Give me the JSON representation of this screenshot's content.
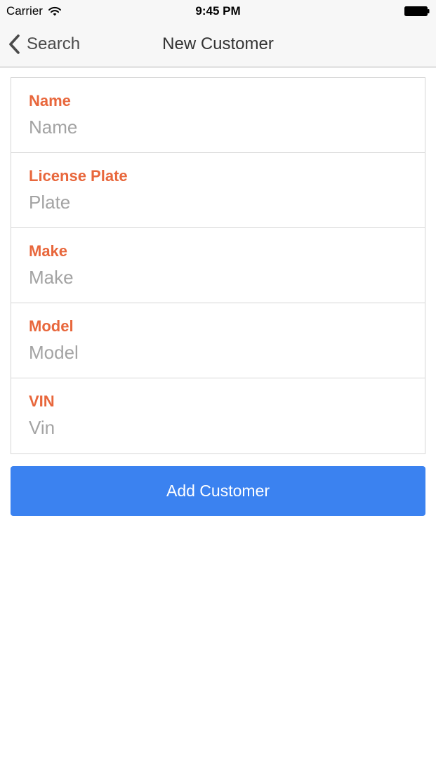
{
  "status_bar": {
    "carrier": "Carrier",
    "time": "9:45 PM",
    "wifi_icon": "wifi-icon",
    "battery_icon": "battery-full-icon"
  },
  "nav": {
    "back_label": "Search",
    "back_icon": "chevron-left-icon",
    "title": "New Customer"
  },
  "form": {
    "fields": [
      {
        "label": "Name",
        "placeholder": "Name",
        "value": ""
      },
      {
        "label": "License Plate",
        "placeholder": "Plate",
        "value": ""
      },
      {
        "label": "Make",
        "placeholder": "Make",
        "value": ""
      },
      {
        "label": "Model",
        "placeholder": "Model",
        "value": ""
      },
      {
        "label": "VIN",
        "placeholder": "Vin",
        "value": ""
      }
    ]
  },
  "actions": {
    "add_customer_label": "Add Customer"
  },
  "colors": {
    "accent_label": "#e8673c",
    "primary_button": "#3b82f0",
    "placeholder": "#a3a3a3",
    "nav_background": "#f7f7f7"
  }
}
